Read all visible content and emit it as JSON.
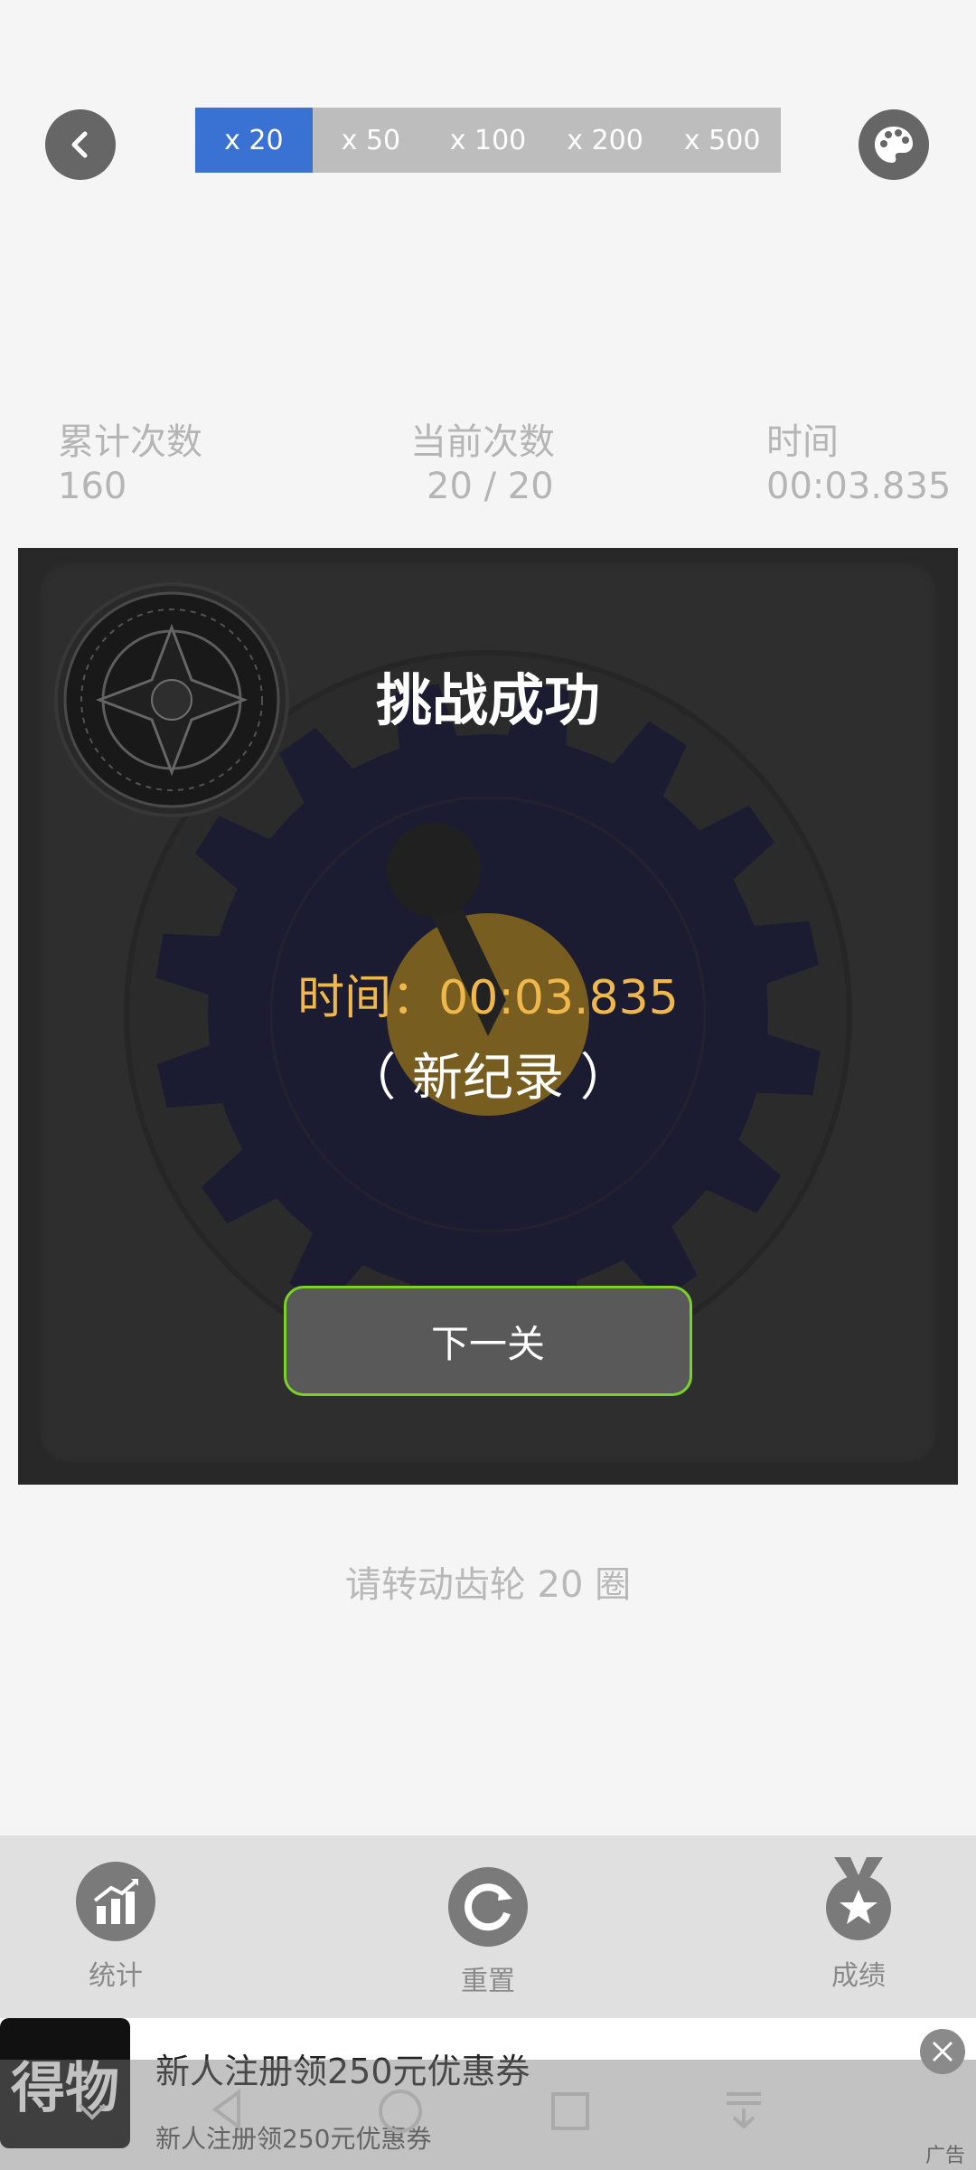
{
  "header": {
    "back_icon": "chevron-left-icon",
    "palette_icon": "palette-icon",
    "segments": [
      "x 20",
      "x 50",
      "x 100",
      "x 200",
      "x 500"
    ],
    "active_segment": 0,
    "accent_color": "#3a72d4"
  },
  "stats": {
    "total_label": "累计次数",
    "total_value": "160",
    "current_label": "当前次数",
    "current_value": "20 / 20",
    "time_label": "时间",
    "time_value": "00:03.835"
  },
  "result": {
    "title": "挑战成功",
    "time_text": "时间：00:03.835",
    "record_text": "（ 新纪录 ）",
    "next_button": "下一关"
  },
  "hint": "请转动齿轮 20 圈",
  "toolbar": {
    "stats_label": "统计",
    "reset_label": "重置",
    "achievements_label": "成绩"
  },
  "ad": {
    "logo_text": "得物",
    "title": "新人注册领250元优惠券",
    "subtitle": "新人注册领250元优惠券",
    "tag": "广告"
  }
}
